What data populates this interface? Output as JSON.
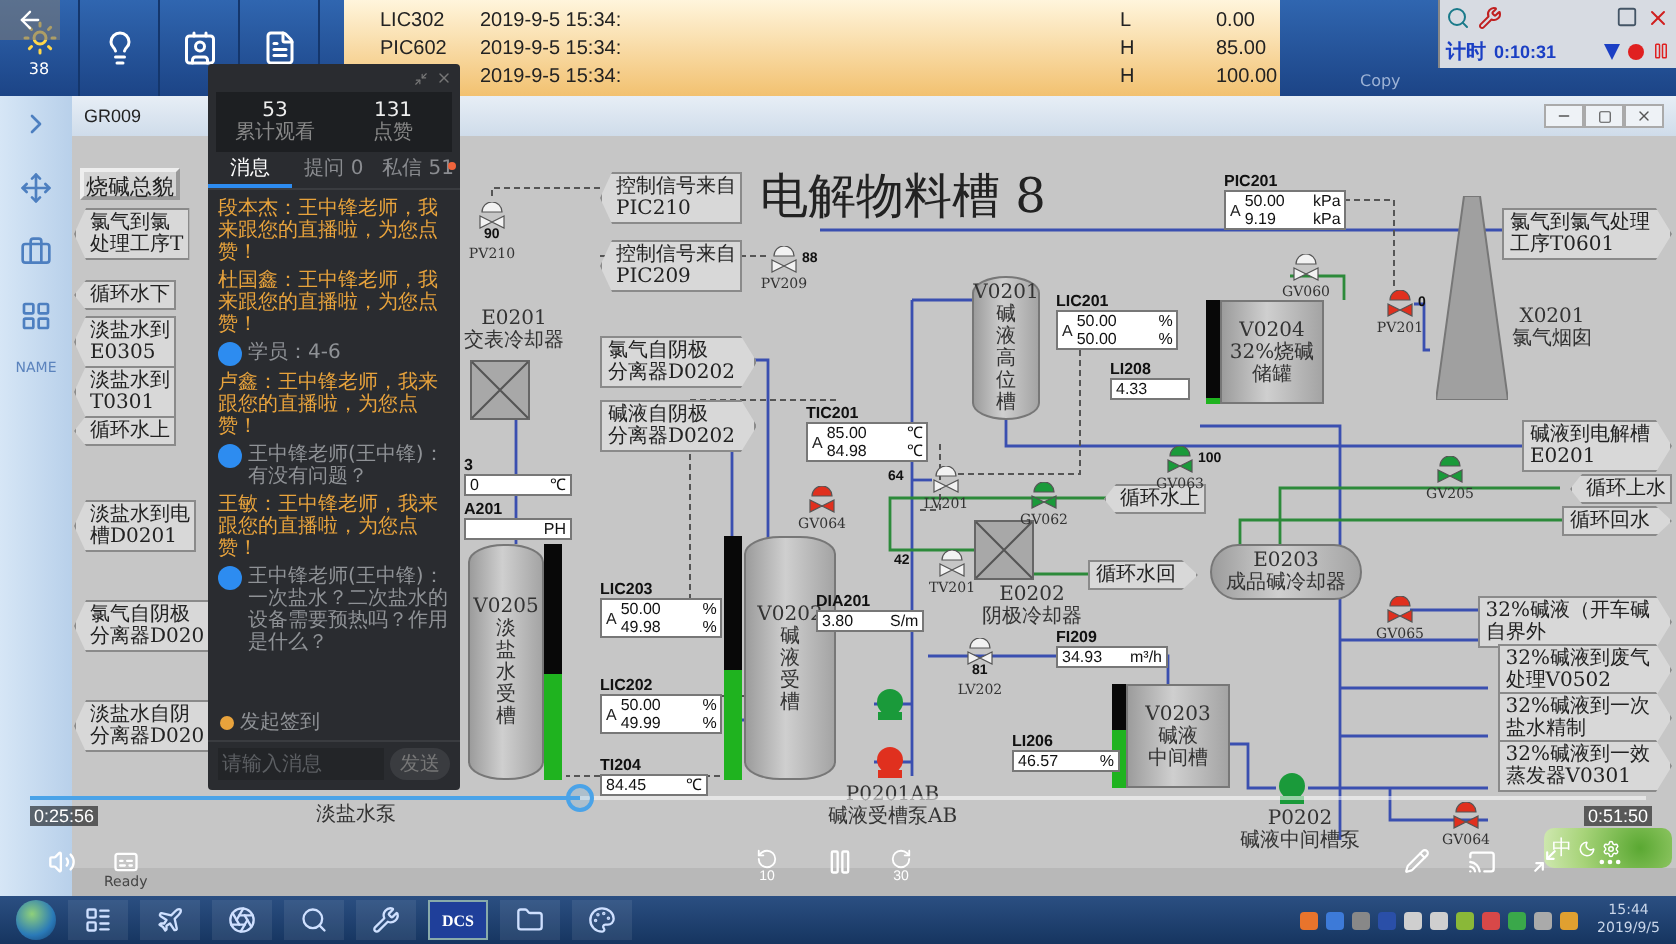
{
  "toolbar": {
    "badge": "38"
  },
  "alarms": [
    {
      "tag": "LIC302",
      "time": "2019-9-5 15:34:",
      "limit": "L",
      "value": "0.00"
    },
    {
      "tag": "PIC602",
      "time": "2019-9-5 15:34:",
      "limit": "H",
      "value": "85.00"
    },
    {
      "time": "2019-9-5 15:34:",
      "limit": "H",
      "value": "100.00"
    }
  ],
  "timer": {
    "label": "计时",
    "time": "0:10:31",
    "copy": "Copy"
  },
  "sidebar": {
    "label": "NAME"
  },
  "window": {
    "title": "GR009"
  },
  "diagram": {
    "overview_button": "烧碱总貌",
    "title": "电解物料槽 8",
    "tags": [
      {
        "lines": [
          "氯气到氯",
          "处理工序T"
        ]
      },
      {
        "lines": [
          "循环水下"
        ]
      },
      {
        "lines": [
          "淡盐水到",
          "E0305"
        ]
      },
      {
        "lines": [
          "淡盐水到",
          "T0301"
        ]
      },
      {
        "lines": [
          "循环水上"
        ]
      },
      {
        "lines": [
          "淡盐水到电",
          "槽D0201"
        ]
      },
      {
        "lines": [
          "氯气自阴极",
          "分离器D020"
        ]
      },
      {
        "lines": [
          "淡盐水自阴",
          "分离器D020"
        ]
      },
      {
        "lines": [
          "控制信号来自",
          "PIC210"
        ]
      },
      {
        "lines": [
          "控制信号来自",
          "PIC209"
        ]
      },
      {
        "lines": [
          "氯气自阴极",
          "分离器D0202"
        ]
      },
      {
        "lines": [
          "碱液自阴极",
          "分离器D0202"
        ]
      },
      {
        "lines": [
          "循环水上"
        ]
      },
      {
        "lines": [
          "循环水回"
        ]
      },
      {
        "lines": [
          "氯气到氯气处理",
          "工序T0601"
        ]
      },
      {
        "lines": [
          "碱液到电解槽",
          "E0201"
        ]
      },
      {
        "lines": [
          "循环上水"
        ]
      },
      {
        "lines": [
          "循环回水"
        ]
      },
      {
        "lines": [
          "32%碱液（开车碱",
          "自界外"
        ]
      },
      {
        "lines": [
          "32%碱液到废气",
          "处理V0502"
        ]
      },
      {
        "lines": [
          "32%碱液到一次",
          "盐水精制"
        ]
      },
      {
        "lines": [
          "32%碱液到一效",
          "蒸发器V0301"
        ]
      }
    ],
    "vessels": [
      {
        "kind": "exchanger",
        "lines": [
          "E0201",
          "交表冷却器"
        ]
      },
      {
        "kind": "vertical",
        "lines": [
          "V0205",
          "淡",
          "盐",
          "水",
          "受",
          "槽"
        ],
        "level": 0.45
      },
      {
        "kind": "vertical",
        "lines": [
          "V0202",
          "碱",
          "液",
          "受",
          "槽"
        ],
        "level": 0.45
      },
      {
        "kind": "vertical",
        "lines": [
          "V0201",
          "碱",
          "液",
          "高",
          "位",
          "槽"
        ]
      },
      {
        "kind": "box",
        "lines": [
          "V0204",
          "32%烧碱",
          "储罐"
        ],
        "level": 0.05
      },
      {
        "kind": "chimney",
        "lines": [
          "X0201",
          "氯气烟囱"
        ]
      },
      {
        "kind": "exchanger",
        "lines": [
          "E0202",
          "阴极冷却器"
        ]
      },
      {
        "kind": "horizontal",
        "lines": [
          "E0203",
          "成品碱冷却器"
        ]
      },
      {
        "kind": "box",
        "lines": [
          "V0203",
          "碱液",
          "中间槽"
        ],
        "level": 0.55
      }
    ],
    "meters": [
      {
        "name": "3",
        "rows": [
          {
            "value": "0",
            "unit": "℃"
          }
        ]
      },
      {
        "name": "A201",
        "rows": [
          {
            "unit": "PH"
          }
        ]
      },
      {
        "name": "LIC203",
        "mode": "A",
        "rows": [
          {
            "value": "50.00",
            "unit": "%"
          },
          {
            "value": "49.98",
            "unit": "%"
          }
        ]
      },
      {
        "name": "LIC202",
        "mode": "A",
        "rows": [
          {
            "value": "50.00",
            "unit": "%"
          },
          {
            "value": "49.99",
            "unit": "%"
          }
        ]
      },
      {
        "name": "TI204",
        "rows": [
          {
            "value": "84.45",
            "unit": "℃"
          }
        ]
      },
      {
        "name": "PIC201",
        "mode": "A",
        "rows": [
          {
            "value": "50.00",
            "unit": "kPa"
          },
          {
            "value": "9.19",
            "unit": "kPa"
          }
        ]
      },
      {
        "name": "LIC201",
        "mode": "A",
        "rows": [
          {
            "value": "50.00",
            "unit": "%"
          },
          {
            "value": "50.00",
            "unit": "%"
          }
        ]
      },
      {
        "name": "LI208",
        "rows": [
          {
            "value": "4.33"
          }
        ]
      },
      {
        "name": "TIC201",
        "mode": "A",
        "rows": [
          {
            "value": "85.00",
            "unit": "℃"
          },
          {
            "value": "84.98",
            "unit": "℃"
          }
        ]
      },
      {
        "name": "DIA201",
        "rows": [
          {
            "value": "3.80",
            "unit": "S/m"
          }
        ]
      },
      {
        "name": "FI209",
        "rows": [
          {
            "value": "34.93",
            "unit": "m³/h"
          }
        ]
      },
      {
        "name": "LI206",
        "rows": [
          {
            "value": "46.57",
            "unit": "%"
          }
        ]
      }
    ],
    "valves": [
      {
        "label": "PV210",
        "reading": "90",
        "color": "#f2f2f2"
      },
      {
        "label": "PV209",
        "reading": "88",
        "color": "#f2f2f2"
      },
      {
        "label": "GV060",
        "color": "#f2f2f2"
      },
      {
        "label": "PV201",
        "reading": "0",
        "color": "#e0301e"
      },
      {
        "label": "GV064",
        "color": "#e0301e"
      },
      {
        "label": "GV063",
        "reading": "100",
        "color": "#1a9a3a"
      },
      {
        "label": "LV201",
        "reading": "64",
        "color": "#f2f2f2"
      },
      {
        "label": "GV062",
        "color": "#1a9a3a"
      },
      {
        "label": "GV205",
        "color": "#1a9a3a"
      },
      {
        "label": "TV201",
        "reading": "42",
        "color": "#f2f2f2"
      },
      {
        "label": "GV065",
        "color": "#e0301e"
      },
      {
        "label": "LV202",
        "reading": "81",
        "color": "#f2f2f2"
      },
      {
        "label": "GV064",
        "color": "#e0301e"
      }
    ],
    "pumps": [
      {
        "color": "#1a9a3a"
      },
      {
        "color": "#e0301e",
        "lines": [
          "P0201AB",
          "碱液受槽泵AB"
        ]
      },
      {
        "color": "#1a9a3a",
        "lines": [
          "P0202",
          "碱液中间槽泵"
        ]
      }
    ],
    "labels": [
      "淡盐水泵"
    ]
  },
  "widget": {
    "label": "中"
  },
  "chat": {
    "stats": [
      {
        "value": "53",
        "label": "累计观看"
      },
      {
        "value": "131",
        "label": "点赞"
      }
    ],
    "tabs": [
      {
        "label": "消息",
        "selected": true,
        "unread": false
      },
      {
        "label": "提问 0",
        "selected": false,
        "unread": false
      },
      {
        "label": "私信 51",
        "selected": false,
        "unread": true
      }
    ],
    "messages": [
      {
        "kind": "join",
        "text": "段本杰：王中锋老师，我来跟您的直播啦，为您点赞！"
      },
      {
        "kind": "join",
        "text": "杜国鑫：王中锋老师，我来跟您的直播啦，为您点赞！"
      },
      {
        "kind": "question",
        "text": "学员：4-6"
      },
      {
        "kind": "join",
        "text": "卢鑫：王中锋老师，我来跟您的直播啦，为您点赞！"
      },
      {
        "kind": "question",
        "text": "王中锋老师(王中锋)：有没有问题？"
      },
      {
        "kind": "join",
        "text": "王敏：王中锋老师，我来跟您的直播啦，为您点赞！"
      },
      {
        "kind": "question",
        "text": "王中锋老师(王中锋)：一次盐水？二次盐水的设备需要预热吗？作用是什么？"
      }
    ],
    "sign_in": "发起签到",
    "input": {
      "placeholder": "请输入消息"
    },
    "send": "发送"
  },
  "player": {
    "elapsed": "0:25:56",
    "total": "0:51:50",
    "level": 0.34,
    "rewind": "10",
    "forward": "30"
  },
  "status": "Ready",
  "taskbar": {
    "dcs": "DCS",
    "time": "15:44",
    "date": "2019/9/5"
  }
}
